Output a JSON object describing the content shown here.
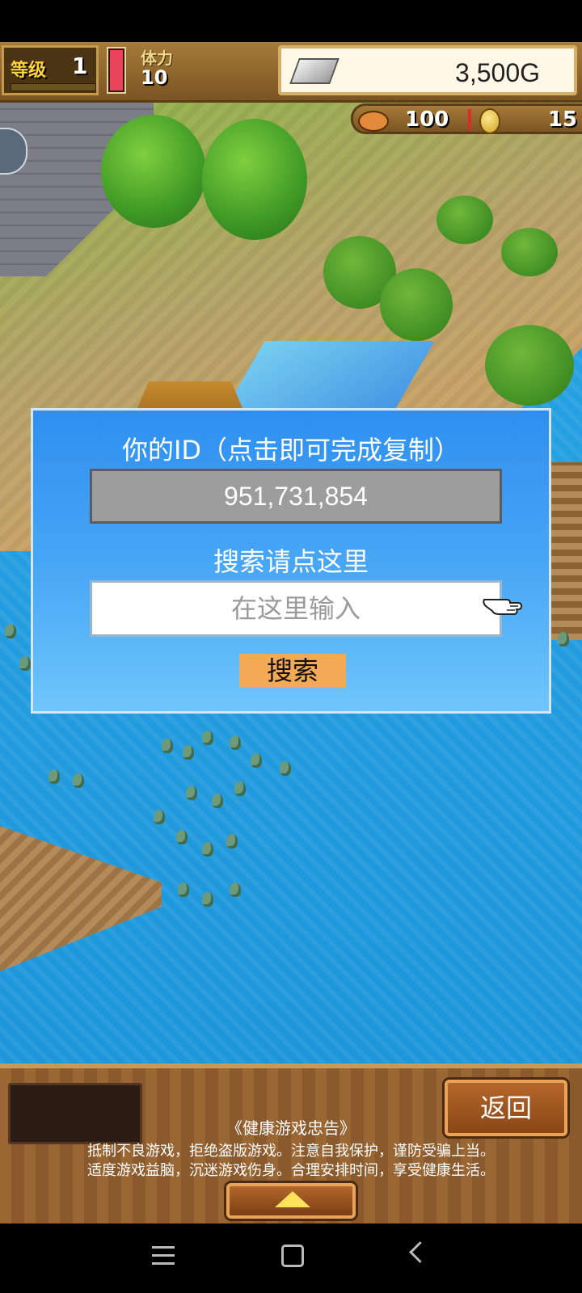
{
  "hud": {
    "level_label": "等级",
    "level_value": "1",
    "stamina_label": "体力",
    "stamina_value": "10",
    "stamina_fill_fraction": 1.0,
    "gold_value": "3,500G",
    "food_value": "100",
    "coin_value": "15"
  },
  "dialog": {
    "title": "你的ID（点击即可完成复制）",
    "player_id": "951,731,854",
    "search_label": "搜索请点这里",
    "search_placeholder": "在这里输入",
    "search_button": "搜索"
  },
  "footer": {
    "back_button": "返回",
    "notice_title": "《健康游戏忠告》",
    "notice_lines": [
      "抵制不良游戏，拒绝盗版游戏。注意自我保护，谨防受骗上当。",
      "适度游戏益脑，沉迷游戏伤身。合理安排时间，享受健康生活。"
    ]
  },
  "colors": {
    "dialog_bg": "#3a9af2",
    "id_box": "#9d9d9d",
    "search_button": "#f3a955",
    "stamina_fill": "#e8455a"
  },
  "icons": [
    "silver-ingot-icon",
    "food-icon",
    "coin-icon",
    "pointing-hand-icon",
    "triangle-up-icon",
    "nav-menu-icon",
    "nav-home-icon",
    "nav-back-icon"
  ]
}
